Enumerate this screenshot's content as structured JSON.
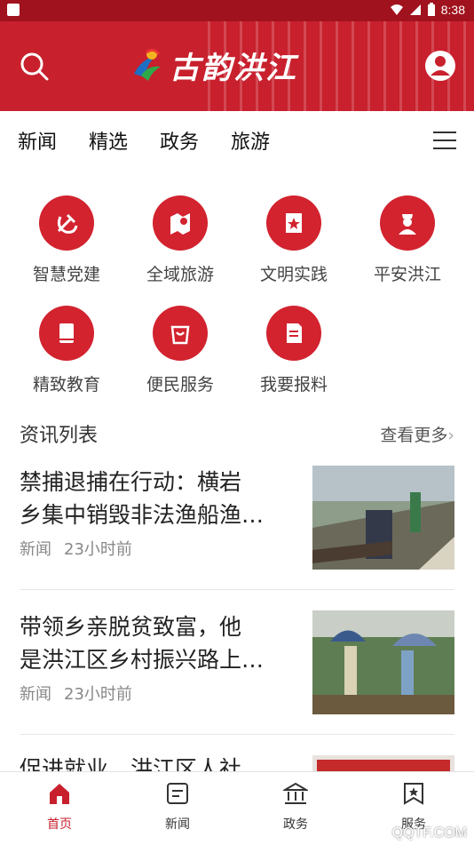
{
  "status_bar": {
    "time": "8:38"
  },
  "header": {
    "logo_text": "古韵洪江"
  },
  "tabs": [
    "新闻",
    "精选",
    "政务",
    "旅游"
  ],
  "shortcuts": [
    {
      "label": "智慧党建",
      "icon": "hammer-sickle-icon"
    },
    {
      "label": "全域旅游",
      "icon": "map-pin-icon"
    },
    {
      "label": "文明实践",
      "icon": "star-badge-icon"
    },
    {
      "label": "平安洪江",
      "icon": "police-icon"
    },
    {
      "label": "精致教育",
      "icon": "book-icon"
    },
    {
      "label": "便民服务",
      "icon": "bag-icon"
    },
    {
      "label": "我要报料",
      "icon": "document-edit-icon"
    }
  ],
  "news_section": {
    "title": "资讯列表",
    "more": "查看更多"
  },
  "news": [
    {
      "title_line1": "禁捕退捕在行动：横岩",
      "title_line2": "乡集中销毁非法渔船渔…",
      "category": "新闻",
      "time": "23小时前"
    },
    {
      "title_line1": "带领乡亲脱贫致富，他",
      "title_line2": "是洪江区乡村振兴路上…",
      "category": "新闻",
      "time": "23小时前"
    },
    {
      "title_line1": "促进就业，洪江区人社",
      "title_line2": "",
      "category": "",
      "time": ""
    }
  ],
  "bottom_nav": [
    {
      "label": "首页",
      "icon": "home-icon",
      "active": true
    },
    {
      "label": "新闻",
      "icon": "news-icon",
      "active": false
    },
    {
      "label": "政务",
      "icon": "government-icon",
      "active": false
    },
    {
      "label": "服务",
      "icon": "service-icon",
      "active": false
    }
  ],
  "watermark": "QQTF.COM",
  "colors": {
    "brand": "#c8202d",
    "icon_bg": "#d2232f"
  }
}
